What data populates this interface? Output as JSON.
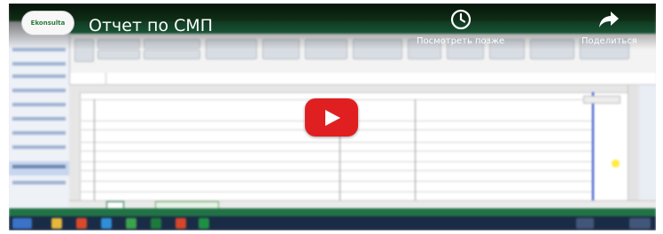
{
  "video": {
    "title": "Отчет по СМП",
    "channel_logo_text": "Ekonsulta",
    "watch_later_label": "Посмотреть позже",
    "share_label": "Поделиться",
    "play_icon": "play-icon",
    "watch_later_icon": "clock-icon",
    "share_icon": "share-arrow-icon"
  },
  "colors": {
    "play_red": "#e02020",
    "excel_green": "#217346",
    "blue_border": "#2b49c9"
  }
}
